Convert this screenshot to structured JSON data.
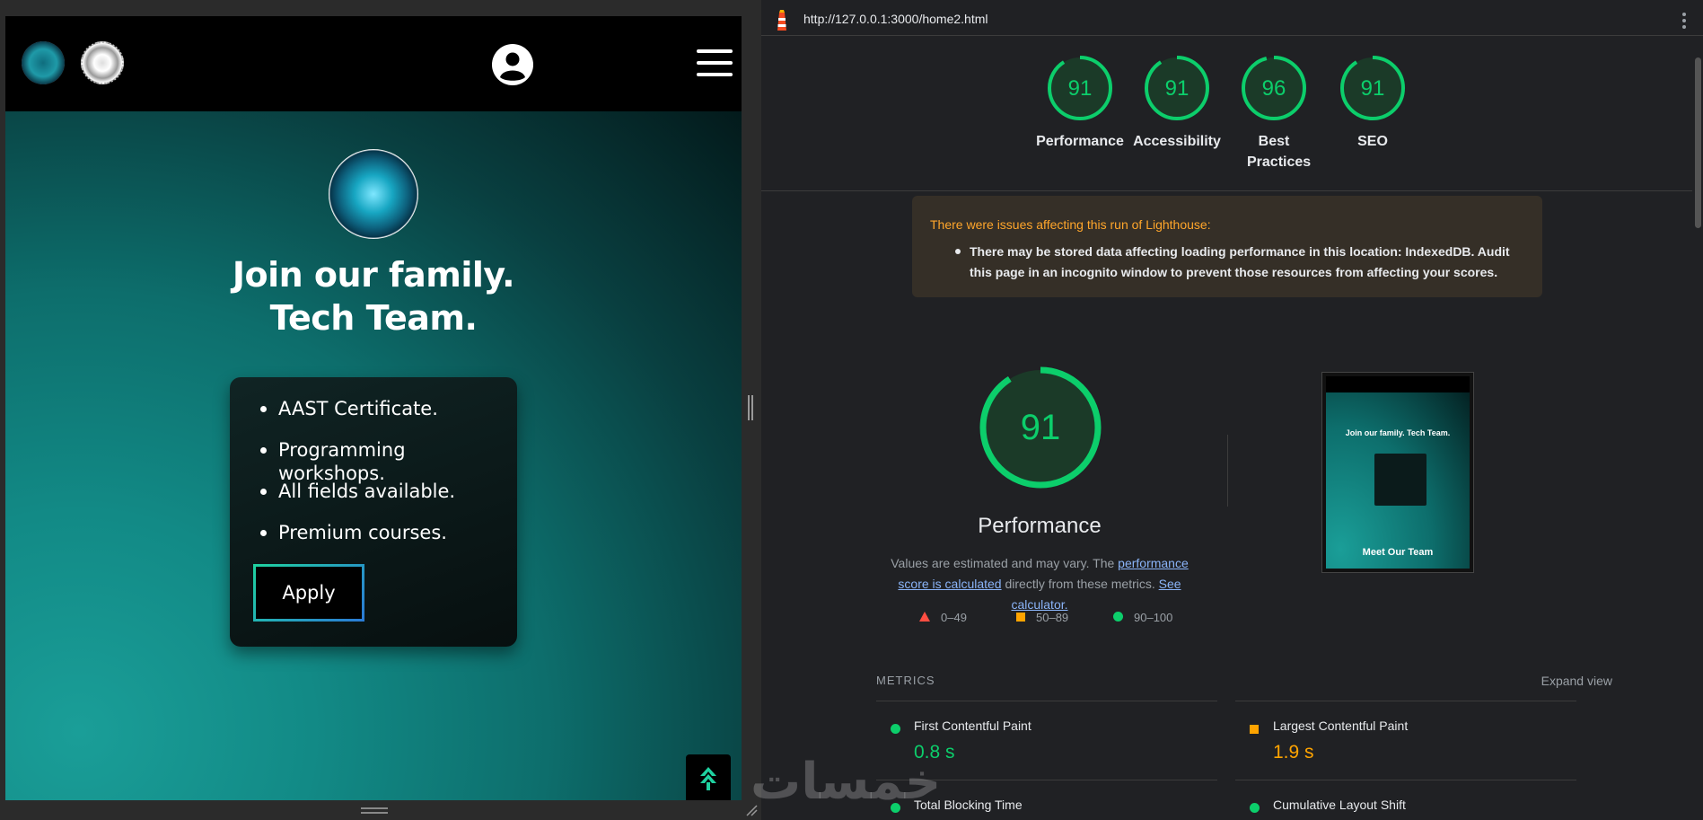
{
  "phone": {
    "hero_title_line1": "Join our family.",
    "hero_title_line2": "Tech Team.",
    "features": [
      "AAST Certificate.",
      "Programming workshops.",
      "All fields available.",
      "Premium courses."
    ],
    "apply_label": "Apply"
  },
  "devtools": {
    "url": "http://127.0.0.1:3000/home2.html",
    "scores": [
      {
        "label": "Performance",
        "value": "91"
      },
      {
        "label": "Accessibility",
        "value": "91"
      },
      {
        "label": "Best Practices",
        "value": "96"
      },
      {
        "label": "SEO",
        "value": "91"
      }
    ],
    "warning_title": "There were issues affecting this run of Lighthouse:",
    "warning_detail": "There may be stored data affecting loading performance in this location: IndexedDB. Audit this page in an incognito window to prevent those resources from affecting your scores.",
    "main_score": "91",
    "main_label": "Performance",
    "disclaimer_pre": "Values are estimated and may vary. The ",
    "disclaimer_link1": "performance score is calculated",
    "disclaimer_mid": " directly from these metrics. ",
    "disclaimer_link2": "See calculator.",
    "legend": [
      "0–49",
      "50–89",
      "90–100"
    ],
    "thumb_title": "Join our family. Tech Team.",
    "thumb_footer": "Meet Our Team",
    "metrics_label": "METRICS",
    "expand_view": "Expand view",
    "metrics": [
      {
        "title": "First Contentful Paint",
        "value": "0.8 s",
        "status": "pass"
      },
      {
        "title": "Largest Contentful Paint",
        "value": "1.9 s",
        "status": "average"
      },
      {
        "title": "Total Blocking Time",
        "value": "",
        "status": "pass"
      },
      {
        "title": "Cumulative Layout Shift",
        "value": "",
        "status": "pass"
      }
    ]
  },
  "colors": {
    "pass": "#0cce6b",
    "average": "#ffa400",
    "fail": "#ff4e42"
  },
  "watermark": "خمسات"
}
